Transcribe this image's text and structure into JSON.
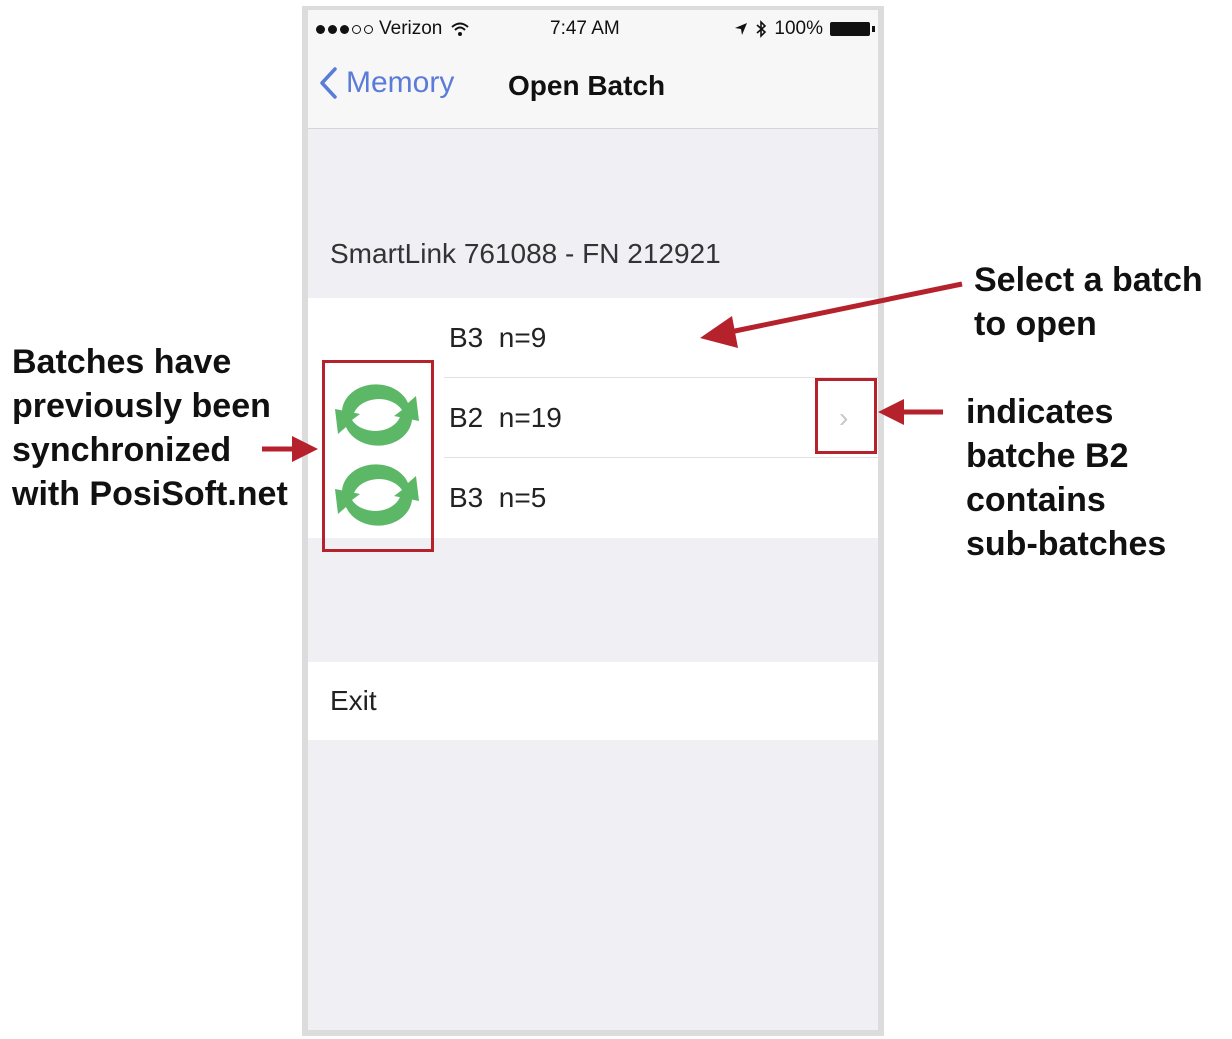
{
  "status_bar": {
    "carrier": "Verizon",
    "time": "7:47 AM",
    "battery_percent": "100%"
  },
  "nav": {
    "back_label": "Memory",
    "title": "Open Batch"
  },
  "section_header": "SmartLink 761088 - FN 212921",
  "batches": [
    {
      "label": "B3  n=9",
      "has_sub_batches": false
    },
    {
      "label": "B2  n=19",
      "has_sub_batches": true
    },
    {
      "label": "B3  n=5",
      "has_sub_batches": false
    }
  ],
  "exit_label": "Exit",
  "annotations": {
    "select": [
      "Select a batch",
      "to open"
    ],
    "synced": [
      "Batches have",
      "previously been",
      "synchronized",
      "with PosiSoft.net"
    ],
    "sub_batches": [
      "indicates",
      "batche B2",
      "contains",
      "sub-batches"
    ]
  },
  "colors": {
    "accent": "#5a7bd8",
    "annotation_red": "#b5222c",
    "sync_green": "#5cb866"
  }
}
